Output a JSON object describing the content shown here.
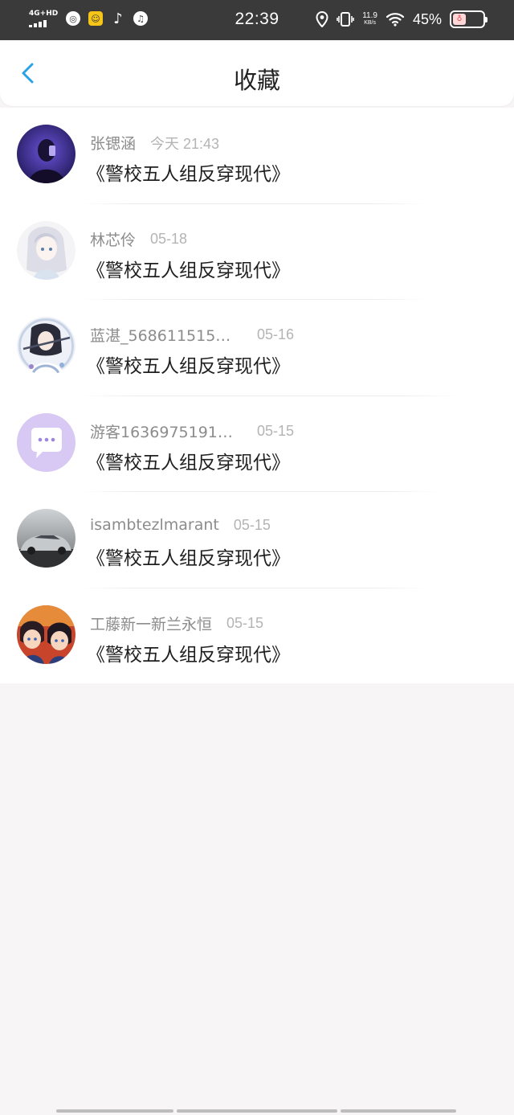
{
  "status_bar": {
    "network": "4G+HD",
    "time": "22:39",
    "speed_value": "11.9",
    "speed_unit": "KB/s",
    "battery": "45%",
    "battery_level": 0.45,
    "icons": [
      "signal-icon",
      "app-icon",
      "app-icon",
      "tiktok-icon",
      "music-icon",
      "location-icon",
      "vibrate-icon",
      "wifi-icon",
      "battery-icon"
    ]
  },
  "header": {
    "title": "收藏",
    "back_icon": "chevron-left-icon",
    "accent": "#2aa3e6"
  },
  "favorites": [
    {
      "user": "张锶涵",
      "time": "今天 21:43",
      "book": "《警校五人组反穿现代》",
      "avatar": "dark-portrait"
    },
    {
      "user": "林芯伶",
      "time": "05-18",
      "book": "《警校五人组反穿现代》",
      "avatar": "anime-girl-white-hair"
    },
    {
      "user": "蓝湛_568611515…",
      "time": "05-16",
      "book": "《警校五人组反穿现代》",
      "avatar": "anime-swordsman"
    },
    {
      "user": "游客1636975191…",
      "time": "05-15",
      "book": "《警校五人组反穿现代》",
      "avatar": "default-chat-avatar"
    },
    {
      "user": "isambtezlmarant",
      "time": "05-15",
      "book": "《警校五人组反穿现代》",
      "avatar": "silver-car"
    },
    {
      "user": "工藤新一新兰永恒",
      "time": "05-15",
      "book": "《警校五人组反穿现代》",
      "avatar": "anime-duo"
    }
  ]
}
